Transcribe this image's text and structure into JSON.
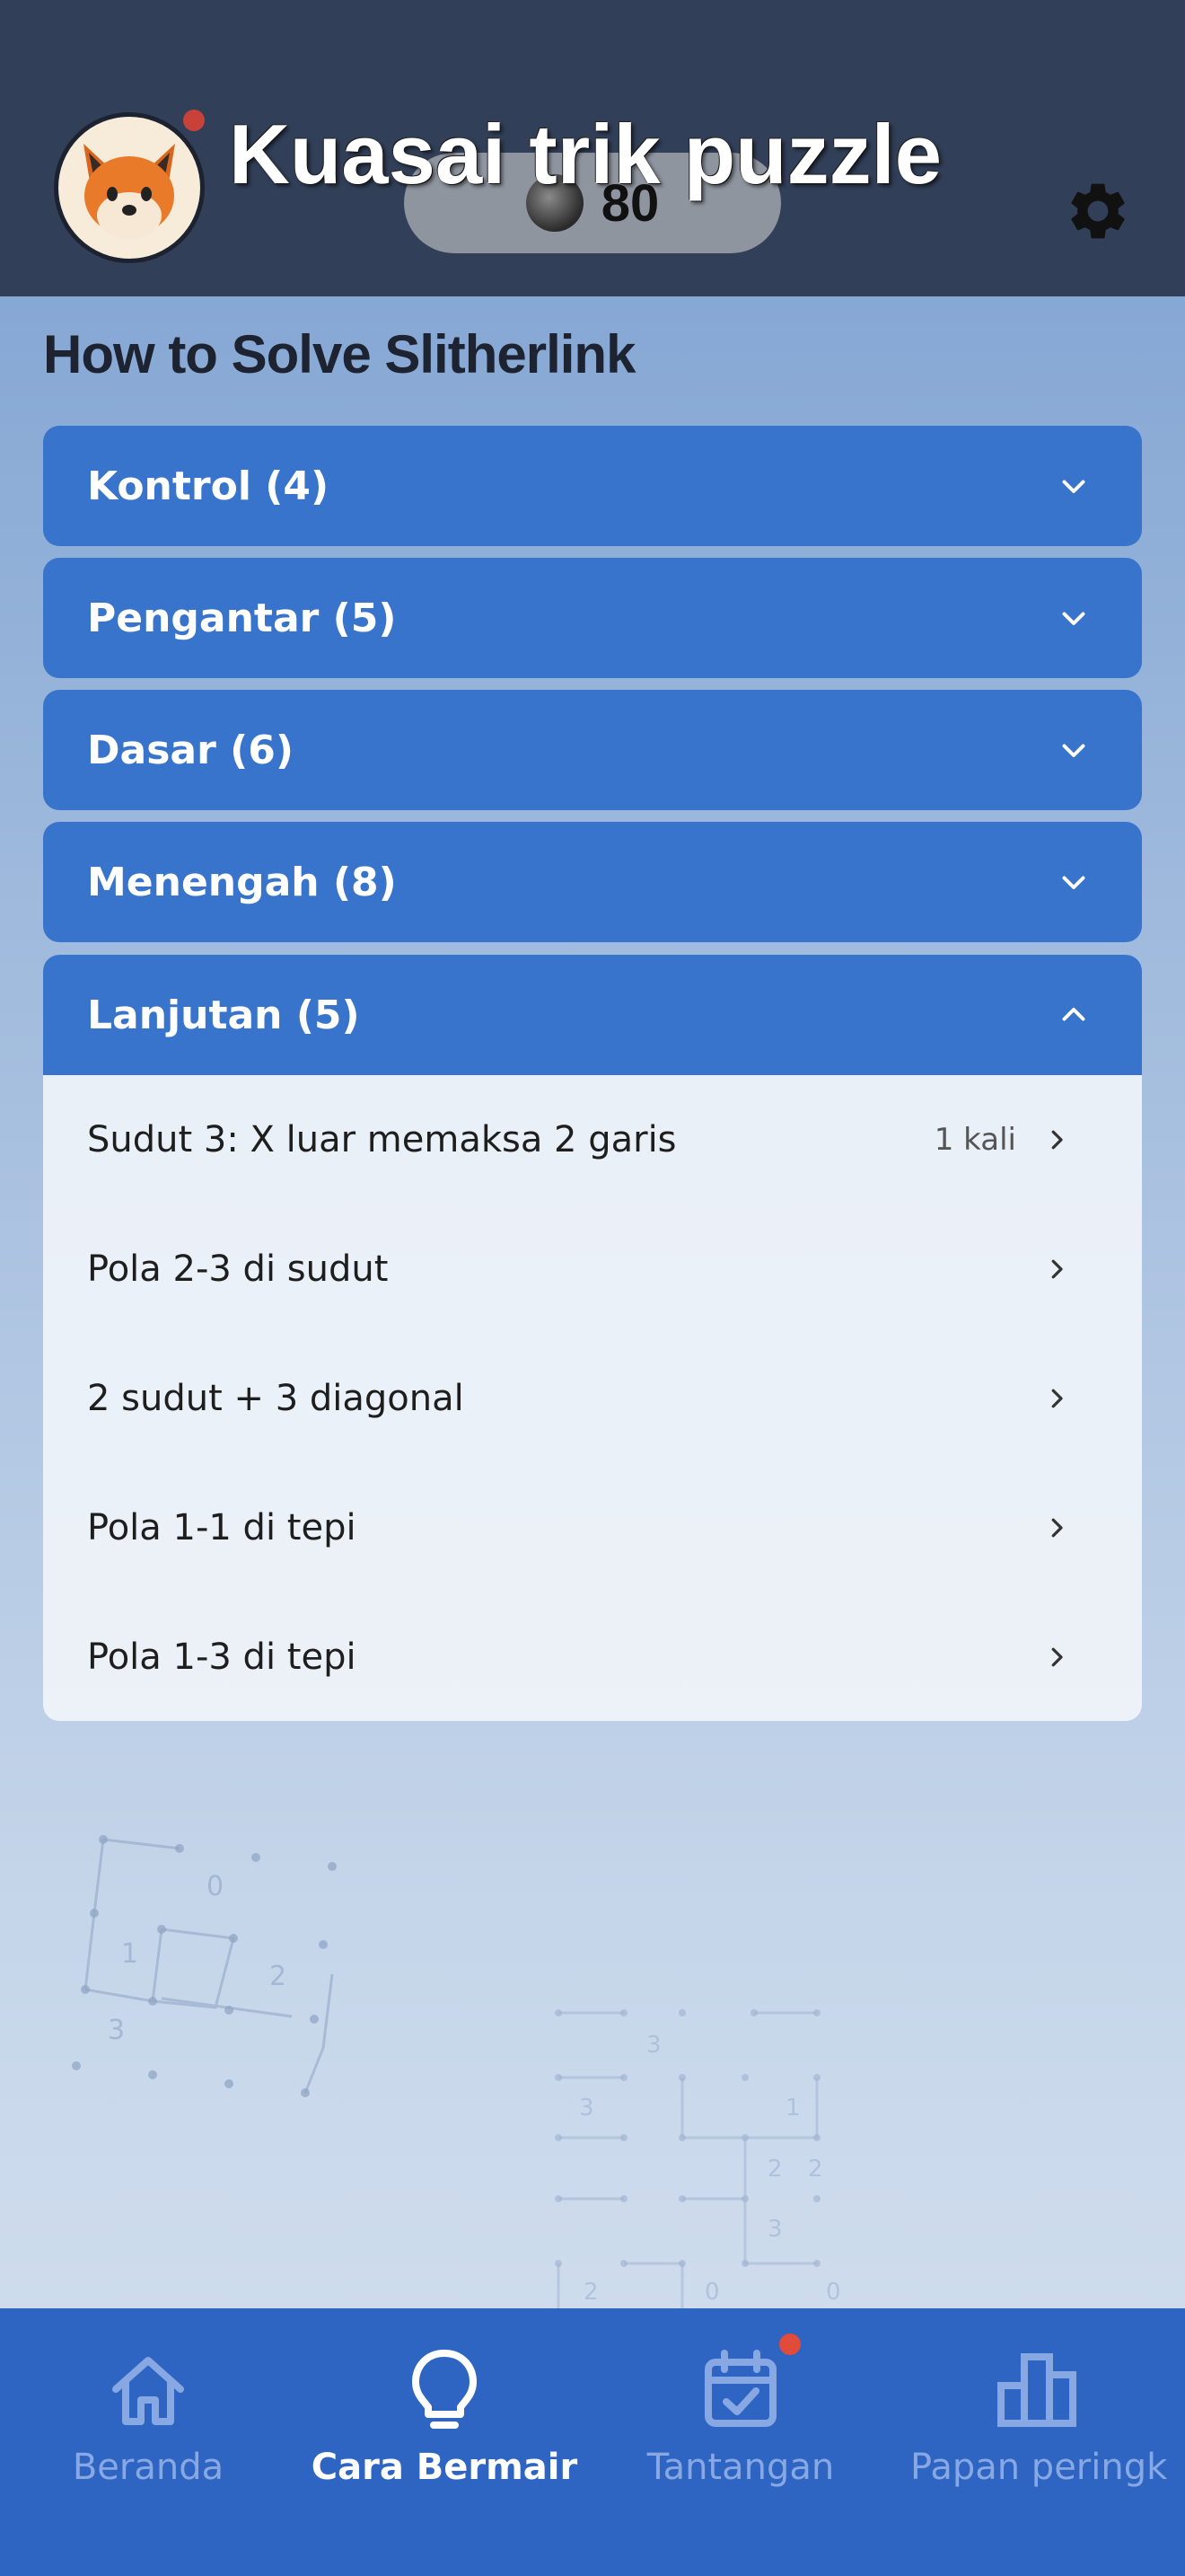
{
  "header": {
    "title": "Kuasai trik puzzle",
    "coins": "80",
    "avatar_icon": "fox-icon",
    "settings_icon": "gear-icon"
  },
  "page": {
    "title": "How to Solve Slitherlink"
  },
  "sections": [
    {
      "label": "Kontrol (4)",
      "expanded": false
    },
    {
      "label": "Pengantar (5)",
      "expanded": false
    },
    {
      "label": "Dasar (6)",
      "expanded": false
    },
    {
      "label": "Menengah (8)",
      "expanded": false
    },
    {
      "label": "Lanjutan (5)",
      "expanded": true
    }
  ],
  "expanded_items": [
    {
      "label": "Sudut 3: X luar memaksa 2 garis",
      "count": "1 kali"
    },
    {
      "label": "Pola 2-3 di sudut",
      "count": ""
    },
    {
      "label": "2 sudut + 3 diagonal",
      "count": ""
    },
    {
      "label": "Pola 1-1 di tepi",
      "count": ""
    },
    {
      "label": "Pola 1-3 di tepi",
      "count": ""
    }
  ],
  "nav": [
    {
      "label": "Beranda",
      "icon": "home-icon",
      "active": false
    },
    {
      "label": "Cara Bermair",
      "icon": "lightbulb-icon",
      "active": true
    },
    {
      "label": "Tantangan",
      "icon": "calendar-check-icon",
      "active": false
    },
    {
      "label": "Papan peringk",
      "icon": "leaderboard-icon",
      "active": false
    }
  ],
  "colors": {
    "header_bg": "#313f58",
    "accent": "#3874cb",
    "nav_bg": "#2f65c2",
    "notification": "#e04b3a"
  }
}
